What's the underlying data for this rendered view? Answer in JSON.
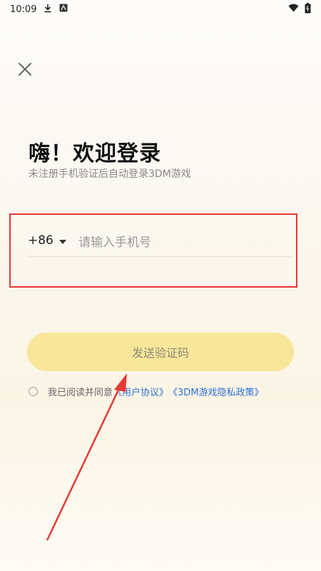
{
  "status_bar": {
    "time": "10:09"
  },
  "header": {
    "title": "嗨！欢迎登录",
    "subtitle": "未注册手机验证后自动登录3DM游戏"
  },
  "phone": {
    "country_code": "+86",
    "placeholder": "请输入手机号",
    "value": ""
  },
  "send_button": {
    "label": "发送验证码"
  },
  "agreement": {
    "prefix": "我已阅读并同意",
    "user_agreement": "《用户协议》",
    "privacy_policy": "《3DM游戏隐私政策》",
    "checked": false
  },
  "colors": {
    "accent": "#f8e79a",
    "link": "#2f6fd6",
    "highlight": "#e53935"
  },
  "icons": [
    "download-icon",
    "app-notification-icon",
    "wifi-icon",
    "battery-icon",
    "close-icon",
    "chevron-down-icon",
    "radio-icon"
  ]
}
